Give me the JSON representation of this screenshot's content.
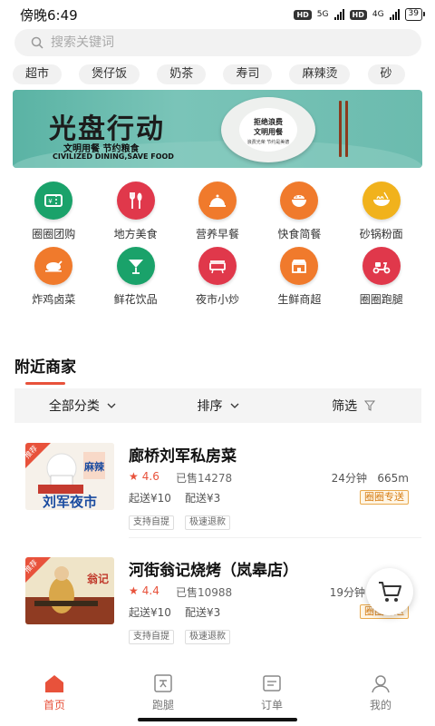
{
  "status_bar": {
    "time": "傍晚6:49",
    "hd1": "HD",
    "net1": "5G",
    "hd2": "HD",
    "net2": "4G",
    "battery": "39"
  },
  "search": {
    "placeholder": "搜索关键词"
  },
  "categories": [
    "超市",
    "煲仔饭",
    "奶茶",
    "寿司",
    "麻辣烫",
    "砂"
  ],
  "banner": {
    "headline": "光盘行动",
    "subtitle": "文明用餐 节约粮食",
    "subtitle_en": "CIVILIZED DINING,SAVE FOOD",
    "plate_line1": "拒绝浪费",
    "plate_line2": "文明用餐",
    "plate_line3": "浪费光荣 节约是美德"
  },
  "services": [
    {
      "label": "圈圈团购",
      "icon": "ticket-icon",
      "color": "#1aa26a"
    },
    {
      "label": "地方美食",
      "icon": "utensils-icon",
      "color": "#e0384b"
    },
    {
      "label": "营养早餐",
      "icon": "cloche-icon",
      "color": "#f07a2c"
    },
    {
      "label": "快食简餐",
      "icon": "rice-bowl-icon",
      "color": "#f07a2c"
    },
    {
      "label": "砂锅粉面",
      "icon": "noodle-bowl-icon",
      "color": "#f1b21c"
    },
    {
      "label": "炸鸡卤菜",
      "icon": "roast-chicken-icon",
      "color": "#f07a2c"
    },
    {
      "label": "鲜花饮品",
      "icon": "cocktail-icon",
      "color": "#1aa26a"
    },
    {
      "label": "夜市小炒",
      "icon": "grill-icon",
      "color": "#e0384b"
    },
    {
      "label": "生鲜商超",
      "icon": "store-icon",
      "color": "#f07a2c"
    },
    {
      "label": "圈圈跑腿",
      "icon": "scooter-icon",
      "color": "#e0384b"
    }
  ],
  "nearby": {
    "title": "附近商家",
    "filters": [
      "全部分类",
      "排序",
      "筛选"
    ]
  },
  "shops": [
    {
      "name": "廊桥刘军私房菜",
      "rating": "4.6",
      "sold": "已售14278",
      "eta": "24分钟",
      "distance": "665m",
      "min_order": "起送¥10",
      "delivery_fee": "配送¥3",
      "badge": "圈圈专送",
      "tags": [
        "支持自提",
        "极速退款"
      ],
      "thumb_text": "刘军夜市",
      "thumb_sign": "麻辣"
    },
    {
      "name": "河街翁记烧烤（岚皋店）",
      "rating": "4.4",
      "sold": "已售10988",
      "eta": "19分钟",
      "distance": "",
      "min_order": "起送¥10",
      "delivery_fee": "配送¥3",
      "badge": "圈圈专送",
      "tags": [
        "支持自提",
        "极速退款"
      ],
      "thumb_text": "",
      "thumb_sign": "翁记"
    }
  ],
  "promo_ribbon": "推荐",
  "bottom_nav": [
    {
      "label": "首页",
      "icon": "home-icon",
      "active": true
    },
    {
      "label": "跑腿",
      "icon": "errand-icon",
      "active": false
    },
    {
      "label": "订单",
      "icon": "order-icon",
      "active": false
    },
    {
      "label": "我的",
      "icon": "profile-icon",
      "active": false
    }
  ],
  "colors": {
    "accent": "#e8523b",
    "badge": "#d67d14"
  }
}
